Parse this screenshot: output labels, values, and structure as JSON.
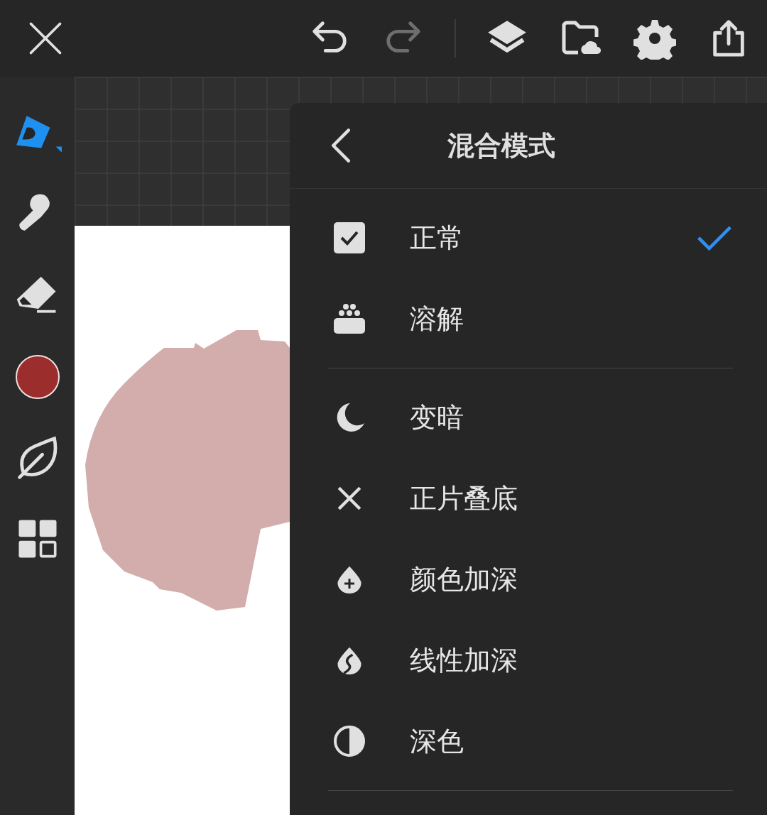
{
  "top_bar": {
    "close": {
      "kind": "close"
    },
    "history": [
      {
        "kind": "undo",
        "disabled": false
      },
      {
        "kind": "redo",
        "disabled": true
      }
    ],
    "actions": [
      {
        "kind": "layers"
      },
      {
        "kind": "gallery"
      },
      {
        "kind": "settings"
      },
      {
        "kind": "share"
      }
    ]
  },
  "tools": [
    {
      "kind": "brush",
      "selected": true
    },
    {
      "kind": "smudge",
      "selected": false
    },
    {
      "kind": "eraser",
      "selected": false
    },
    {
      "kind": "color",
      "color": "#9b2d2d"
    },
    {
      "kind": "leaf",
      "selected": false
    },
    {
      "kind": "grid"
    }
  ],
  "blend_panel": {
    "title": "混合模式",
    "groups": [
      [
        {
          "label": "正常",
          "kind": "normal",
          "selected": true
        },
        {
          "label": "溶解",
          "kind": "dissolve",
          "selected": false
        }
      ],
      [
        {
          "label": "变暗",
          "kind": "darken",
          "selected": false
        },
        {
          "label": "正片叠底",
          "kind": "multiply",
          "selected": false
        },
        {
          "label": "颜色加深",
          "kind": "color-burn",
          "selected": false
        },
        {
          "label": "线性加深",
          "kind": "linear-burn",
          "selected": false
        },
        {
          "label": "深色",
          "kind": "darker-color",
          "selected": false
        }
      ]
    ]
  }
}
